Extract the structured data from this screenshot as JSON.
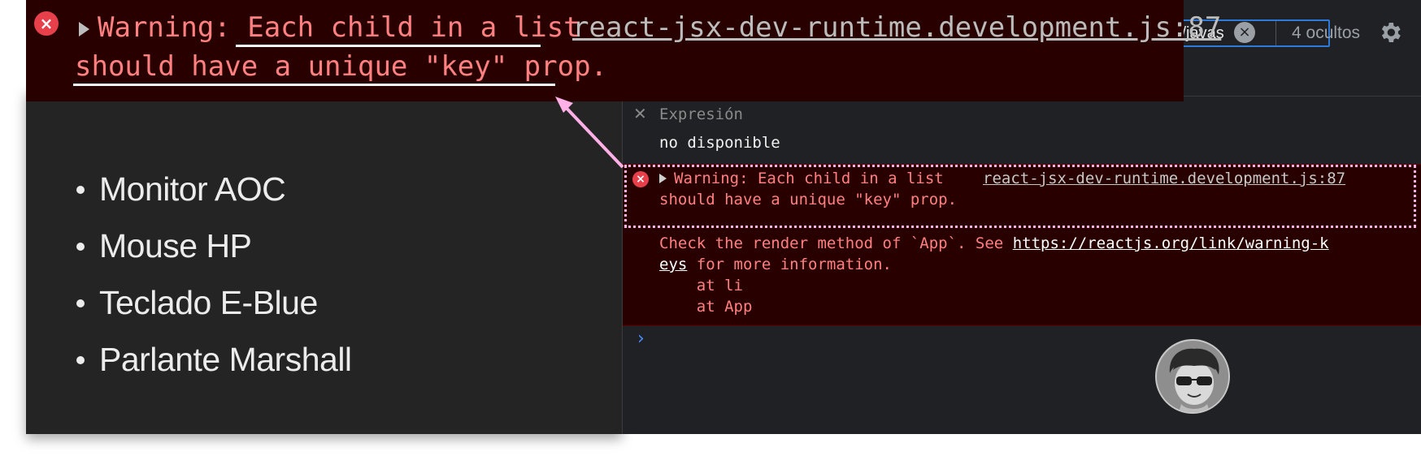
{
  "products": {
    "items": [
      "Monitor AOC",
      "Mouse HP",
      "Teclado E-Blue",
      "Parlante Marshall"
    ]
  },
  "console": {
    "filter_value": "l/javas",
    "hidden_count": "4 ocultos",
    "expression": {
      "label": "Expresión",
      "value": "no disponible"
    },
    "error": {
      "line1": "Warning: Each child in a list",
      "line2": "should have a unique \"key\" prop.",
      "source": "react-jsx-dev-runtime.development.js:87",
      "detail_pre": "Check the render method of `App`. See ",
      "detail_link_a": "https://reactjs.org/link/warning-k",
      "detail_link_b": "eys",
      "detail_post": " for more information.",
      "stack1": "    at li",
      "stack2": "    at App"
    },
    "prompt": "›"
  },
  "callout": {
    "pre": "Warning: ",
    "highlight": "Each child in a list",
    "line2": "should have a unique \"key\" prop.",
    "source": "react-jsx-dev-runtime.development.js:87"
  },
  "colors": {
    "error_bg": "#290000",
    "error_text": "#ff8080",
    "highlight_frame": "#ffb0e6",
    "accent_blue": "#2f79d8"
  }
}
